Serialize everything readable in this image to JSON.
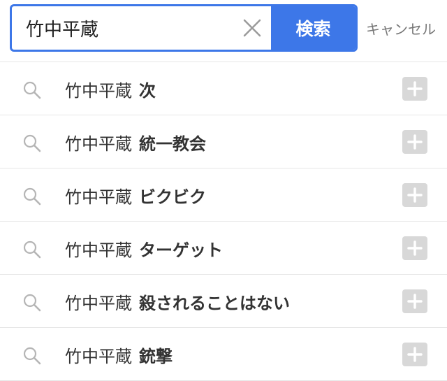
{
  "search": {
    "value": "竹中平蔵",
    "button_label": "検索",
    "cancel_label": "キャンセル",
    "accent_color": "#3d77e8"
  },
  "icons": {
    "clear": "close-icon",
    "suggestion": "search-icon",
    "append": "plus-icon"
  },
  "suggestions": [
    {
      "query": "竹中平蔵",
      "term": "次"
    },
    {
      "query": "竹中平蔵",
      "term": "統一教会"
    },
    {
      "query": "竹中平蔵",
      "term": "ビクビク"
    },
    {
      "query": "竹中平蔵",
      "term": "ターゲット"
    },
    {
      "query": "竹中平蔵",
      "term": "殺されることはない"
    },
    {
      "query": "竹中平蔵",
      "term": "銃撃"
    }
  ]
}
